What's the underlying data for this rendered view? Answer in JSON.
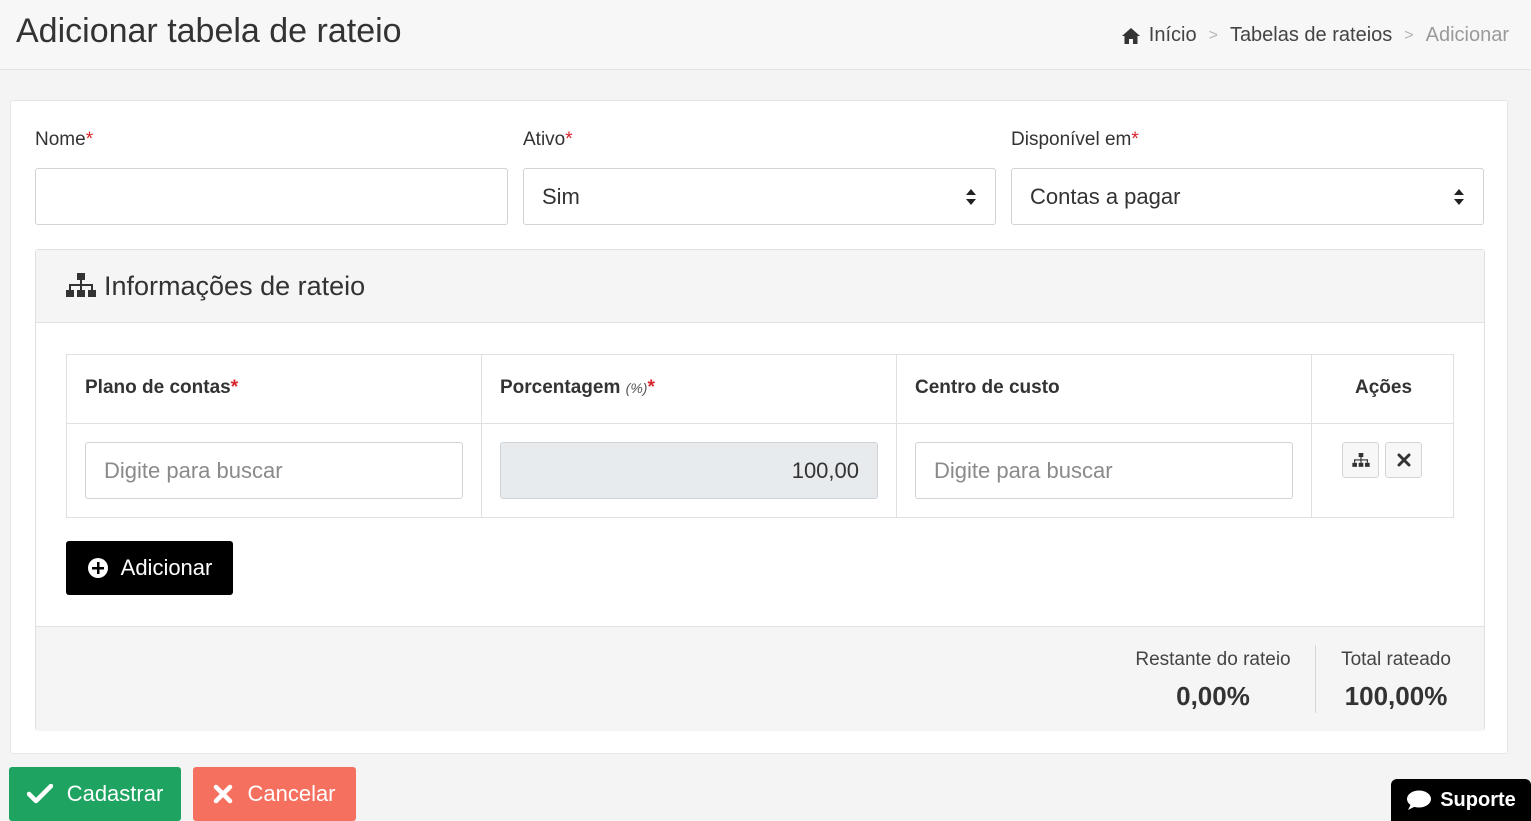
{
  "header": {
    "title": "Adicionar tabela de rateio",
    "breadcrumb": {
      "home": "Início",
      "separator": ">",
      "parent": "Tabelas de rateios",
      "current": "Adicionar"
    }
  },
  "form": {
    "nome": {
      "label": "Nome",
      "required_mark": "*",
      "value": ""
    },
    "ativo": {
      "label": "Ativo",
      "required_mark": "*",
      "selected": "Sim"
    },
    "disponivel": {
      "label": "Disponível em",
      "required_mark": "*",
      "selected": "Contas a pagar"
    }
  },
  "rateio": {
    "title": "Informações de rateio",
    "columns": {
      "plano": {
        "label": "Plano de contas",
        "required_mark": "*"
      },
      "porcentagem": {
        "label": "Porcentagem",
        "unit": "(%)",
        "required_mark": "*"
      },
      "centro": {
        "label": "Centro de custo"
      },
      "acoes": {
        "label": "Ações"
      }
    },
    "row": {
      "plano_placeholder": "Digite para buscar",
      "porcentagem_value": "100,00",
      "centro_placeholder": "Digite para buscar"
    },
    "add_label": "Adicionar",
    "summary": {
      "restante_label": "Restante do rateio",
      "restante_value": "0,00%",
      "total_label": "Total rateado",
      "total_value": "100,00%"
    }
  },
  "actions": {
    "save_label": "Cadastrar",
    "cancel_label": "Cancelar"
  },
  "support": {
    "label": "Suporte"
  },
  "colors": {
    "save": "#1ea460",
    "cancel": "#f5705e",
    "required": "#d9242b",
    "dark_button": "#000000"
  }
}
